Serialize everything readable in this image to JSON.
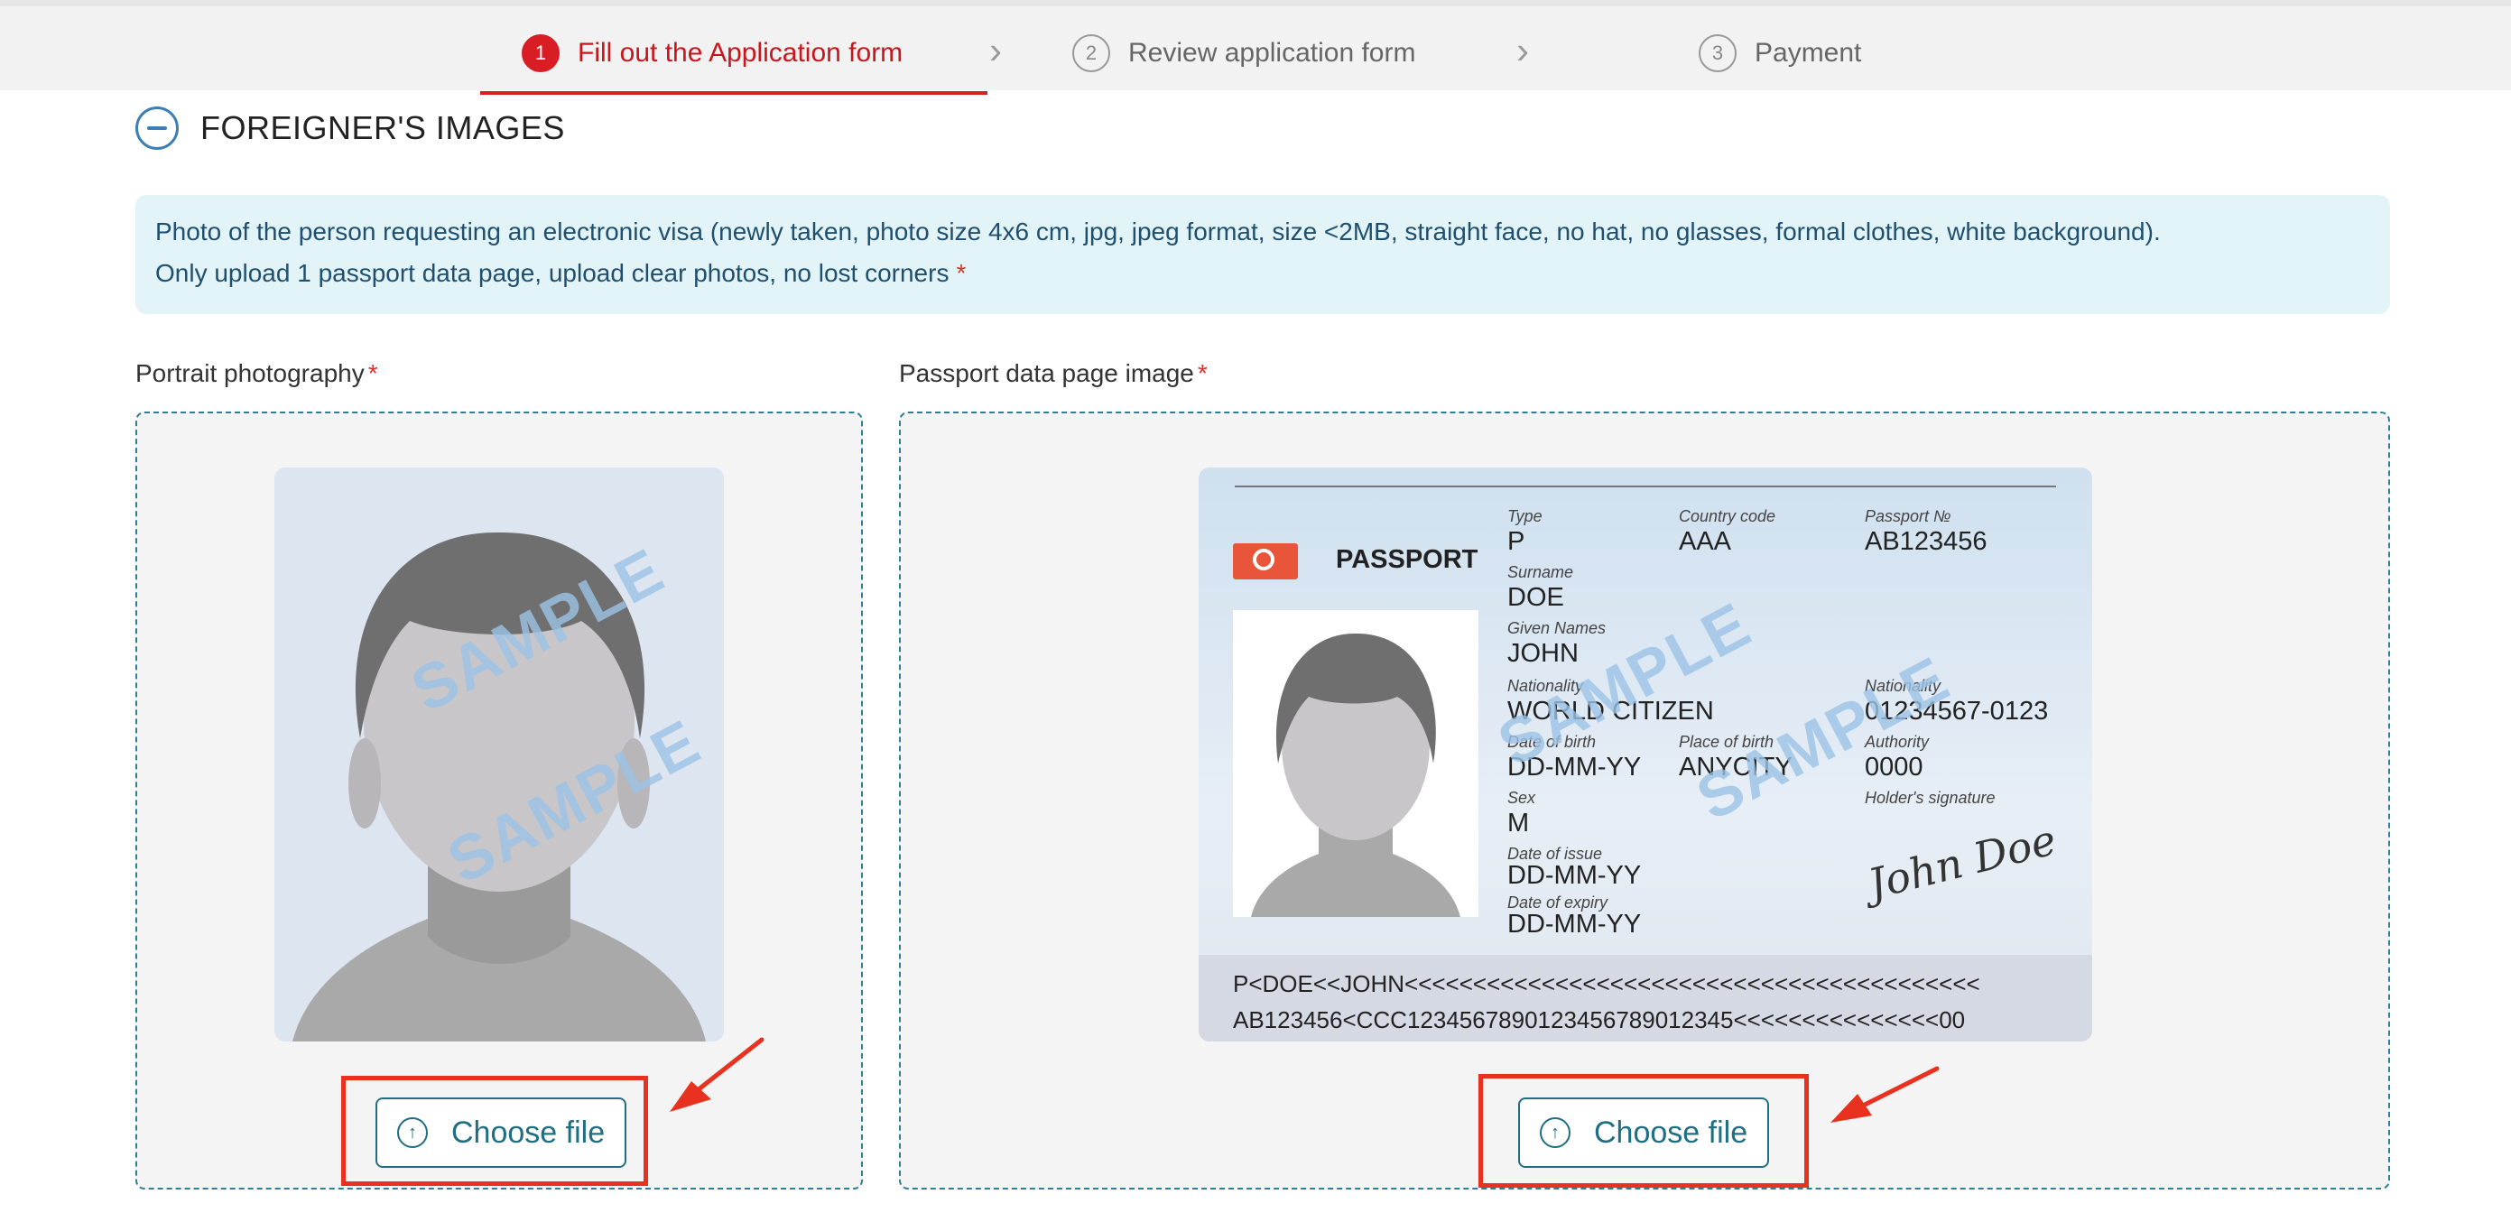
{
  "stepper": {
    "steps": [
      {
        "num": "1",
        "label": "Fill out the Application form",
        "active": true
      },
      {
        "num": "2",
        "label": "Review application form",
        "active": false
      },
      {
        "num": "3",
        "label": "Payment",
        "active": false
      }
    ]
  },
  "section": {
    "title": "FOREIGNER'S IMAGES"
  },
  "notice": {
    "line1": "Photo of the person requesting an electronic visa (newly taken, photo size 4x6 cm, jpg, jpeg format, size <2MB, straight face, no hat, no glasses, formal clothes, white background).",
    "line2": "Only upload 1 passport data page, upload clear photos, no lost corners",
    "required_mark": "*"
  },
  "portrait": {
    "label": "Portrait photography",
    "required_mark": "*",
    "watermark": "SAMPLE",
    "button_label": "Choose file"
  },
  "passport": {
    "label": "Passport data page image",
    "required_mark": "*",
    "watermark": "SAMPLE",
    "button_label": "Choose file",
    "title": "PASSPORT",
    "fields": {
      "type_label": "Type",
      "type": "P",
      "country_code_label": "Country code",
      "country_code": "AAA",
      "passport_no_label": "Passport №",
      "passport_no": "AB123456",
      "surname_label": "Surname",
      "surname": "DOE",
      "given_names_label": "Given Names",
      "given_names": "JOHN",
      "nationality_label": "Nationality",
      "nationality": "WORLD CITIZEN",
      "nationality2_label": "Nationality",
      "personal_no": "01234567-0123",
      "dob_label": "Date of birth",
      "dob": "DD-MM-YY",
      "pob_label": "Place of birth",
      "pob": "ANYCITY",
      "authority_label": "Authority",
      "authority": "0000",
      "sex_label": "Sex",
      "sex": "M",
      "holder_sig_label": "Holder's signature",
      "signature": "John Doe",
      "issue_label": "Date of issue",
      "issue": "DD-MM-YY",
      "expiry_label": "Date of expiry",
      "expiry": "DD-MM-YY"
    },
    "mrz1": "P<DOE<<JOHN<<<<<<<<<<<<<<<<<<<<<<<<<<<<<<<<<<<<<<<<<<",
    "mrz2": "AB123456<CCC1234567890123456789012345<<<<<<<<<<<<<<<00"
  },
  "colors": {
    "accent": "#d91d24",
    "teal": "#1f6e82",
    "annotation": "#e8321f"
  }
}
